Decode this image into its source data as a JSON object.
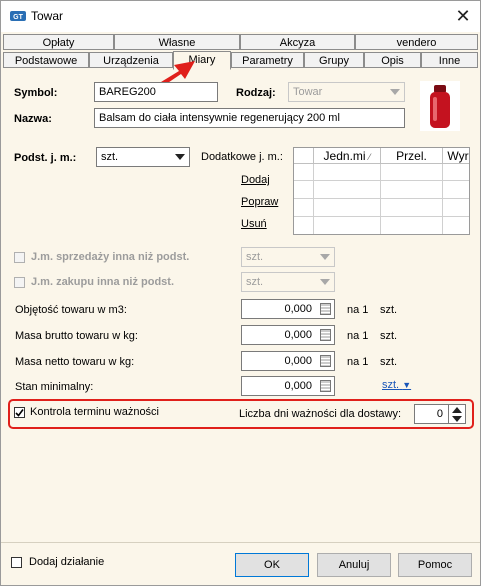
{
  "window": {
    "title": "Towar",
    "close_glyph": "✕"
  },
  "tabs_row1": [
    {
      "label": "Opłaty"
    },
    {
      "label": "Własne"
    },
    {
      "label": "Akcyza"
    },
    {
      "label": "vendero"
    }
  ],
  "tabs_row2": [
    {
      "label": "Podstawowe"
    },
    {
      "label": "Urządzenia"
    },
    {
      "label": "Miary"
    },
    {
      "label": "Parametry"
    },
    {
      "label": "Grupy"
    },
    {
      "label": "Opis"
    },
    {
      "label": "Inne"
    }
  ],
  "active_tab": "Miary",
  "form": {
    "symbol_label": "Symbol:",
    "symbol_value": "BAREG200",
    "rodzaj_label": "Rodzaj:",
    "rodzaj_value": "Towar",
    "nazwa_label": "Nazwa:",
    "nazwa_value": "Balsam do ciała intensywnie regenerujący 200 ml",
    "podst_jm_label": "Podst. j. m.:",
    "podst_jm_value": "szt.",
    "dodatkowe_label": "Dodatkowe j. m.:",
    "dodaj_link": "Dodaj",
    "popraw_link": "Popraw",
    "usun_link": "Usuń",
    "grid_headers": [
      "Jedn.mi",
      "Przel.",
      "Wyr"
    ],
    "jm_sprzedazy_label": "J.m. sprzedaży inna niż podst.",
    "jm_sprzedazy_value": "szt.",
    "jm_zakupu_label": "J.m. zakupu inna niż podst.",
    "jm_zakupu_value": "szt.",
    "rows": [
      {
        "label": "Objętość towaru w m3:",
        "value": "0,000",
        "na": "na 1",
        "unit": "szt."
      },
      {
        "label": "Masa brutto towaru w kg:",
        "value": "0,000",
        "na": "na 1",
        "unit": "szt."
      },
      {
        "label": "Masa netto towaru w kg:",
        "value": "0,000",
        "na": "na 1",
        "unit": "szt."
      },
      {
        "label": "Stan minimalny:",
        "value": "0,000",
        "na": "",
        "unit": "szt."
      }
    ],
    "kontrola_label": "Kontrola terminu ważności",
    "kontrola_checked": true,
    "liczba_dni_label": "Liczba dni ważności dla dostawy:",
    "liczba_dni_value": "0"
  },
  "footer": {
    "dodaj_dzialanie": "Dodaj działanie",
    "ok": "OK",
    "anuluj": "Anuluj",
    "pomoc": "Pomoc"
  },
  "colors": {
    "highlight": "#e0201b",
    "background": "#fbf6ea"
  }
}
